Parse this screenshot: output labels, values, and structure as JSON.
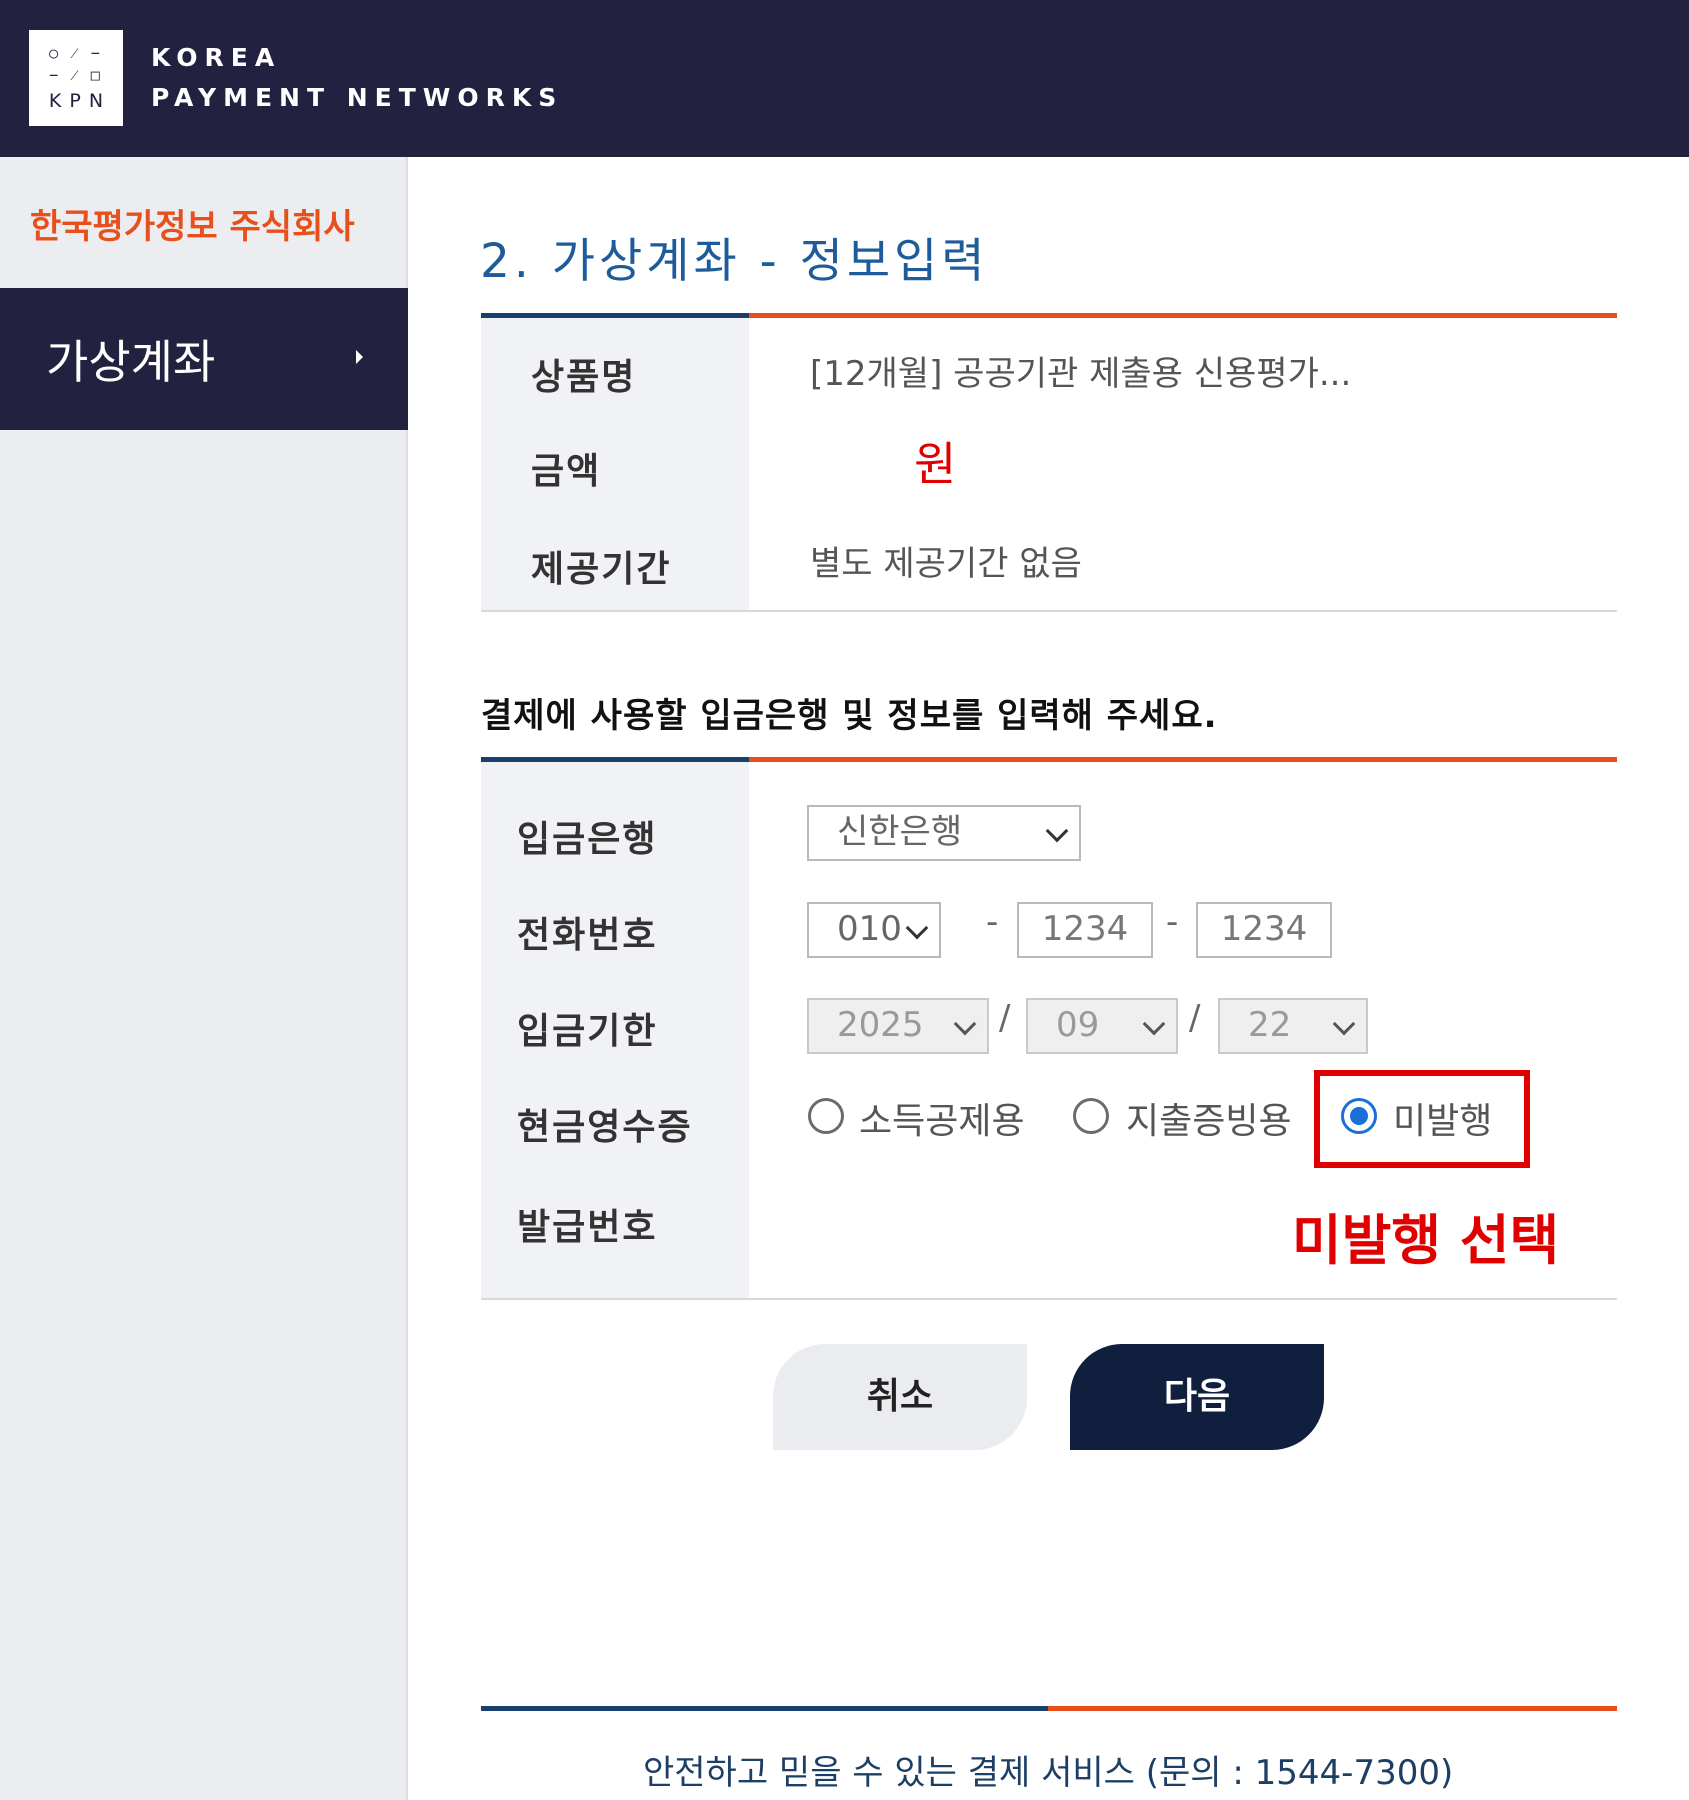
{
  "header": {
    "logo_glyphs": "○ ⁄ −\n− ⁄ □",
    "logo_text": "KPN",
    "brand_line1": "KOREA",
    "brand_line2": "PAYMENT NETWORKS"
  },
  "sidebar": {
    "company": "한국평가정보 주식회사",
    "menu_item": "가상계좌"
  },
  "main": {
    "title": "2. 가상계좌 - 정보입력",
    "info": {
      "product_label": "상품명",
      "product_value": "[12개월] 공공기관 제출용 신용평가...",
      "amount_label": "금액",
      "amount_value": "원",
      "period_label": "제공기간",
      "period_value": "별도 제공기간 없음"
    },
    "instruction": "결제에 사용할 입금은행 및 정보를 입력해 주세요.",
    "form": {
      "bank_label": "입금은행",
      "bank_value": "신한은행",
      "phone_label": "전화번호",
      "phone_prefix": "010",
      "phone_mid": "1234",
      "phone_last": "1234",
      "phone_sep": "-",
      "deadline_label": "입금기한",
      "deadline_year": "2025",
      "deadline_month": "09",
      "deadline_day": "22",
      "date_sep": "/",
      "receipt_label": "현금영수증",
      "receipt_options": [
        "소득공제용",
        "지출증빙용",
        "미발행"
      ],
      "receipt_selected": "미발행",
      "issue_label": "발급번호"
    },
    "annotation": "미발행 선택",
    "buttons": {
      "cancel": "취소",
      "next": "다음"
    },
    "footer": "안전하고 믿을 수 있는 결제 서비스 (문의 : 1544-7300)"
  },
  "colors": {
    "header_bg": "#232140",
    "accent_orange": "#e8501b",
    "accent_navy": "#18406b",
    "title_blue": "#1d5b9a",
    "highlight_red": "#e00000",
    "next_button": "#0f1f3d"
  }
}
